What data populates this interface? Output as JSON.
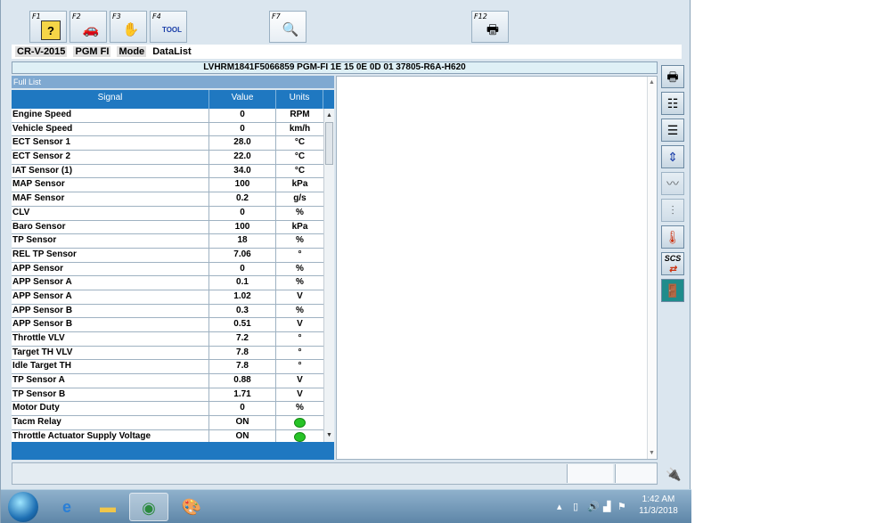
{
  "toolbar": {
    "keys": [
      {
        "label": "F1",
        "icon": "help-icon"
      },
      {
        "label": "F2",
        "icon": "car-icon"
      },
      {
        "label": "F3",
        "icon": "service-icon"
      },
      {
        "label": "F4",
        "icon": "tool-icon",
        "icon_text": "TOOL"
      },
      {
        "label": "F7",
        "icon": "datalist-icon"
      },
      {
        "label": "F12",
        "icon": "print-screen-icon"
      }
    ]
  },
  "breadcrumb": {
    "items": [
      "CR-V-2015",
      "PGM FI",
      "Mode",
      "DataList"
    ]
  },
  "vin_bar": "LVHRM1841F5066859  PGM-FI  1E 15 0E 0D 01  37805-R6A-H620",
  "list": {
    "title": "Full List",
    "columns": [
      "Signal",
      "Value",
      "Units"
    ],
    "rows": [
      {
        "signal": "Engine Speed",
        "value": "0",
        "unit": "RPM"
      },
      {
        "signal": "Vehicle Speed",
        "value": "0",
        "unit": "km/h"
      },
      {
        "signal": "ECT Sensor 1",
        "value": "28.0",
        "unit": "°C"
      },
      {
        "signal": "ECT Sensor 2",
        "value": "22.0",
        "unit": "°C"
      },
      {
        "signal": "IAT Sensor (1)",
        "value": "34.0",
        "unit": "°C"
      },
      {
        "signal": "MAP Sensor",
        "value": "100",
        "unit": "kPa"
      },
      {
        "signal": "MAF Sensor",
        "value": "0.2",
        "unit": "g/s"
      },
      {
        "signal": "CLV",
        "value": "0",
        "unit": "%"
      },
      {
        "signal": "Baro Sensor",
        "value": "100",
        "unit": "kPa"
      },
      {
        "signal": "TP Sensor",
        "value": "18",
        "unit": "%"
      },
      {
        "signal": "REL TP Sensor",
        "value": "7.06",
        "unit": "°"
      },
      {
        "signal": "APP Sensor",
        "value": "0",
        "unit": "%"
      },
      {
        "signal": "APP Sensor A",
        "value": "0.1",
        "unit": "%"
      },
      {
        "signal": "APP Sensor A",
        "value": "1.02",
        "unit": "V"
      },
      {
        "signal": "APP Sensor B",
        "value": "0.3",
        "unit": "%"
      },
      {
        "signal": "APP Sensor B",
        "value": "0.51",
        "unit": "V"
      },
      {
        "signal": "Throttle VLV",
        "value": "7.2",
        "unit": "°"
      },
      {
        "signal": "Target TH VLV",
        "value": "7.8",
        "unit": "°"
      },
      {
        "signal": "Idle Target TH",
        "value": "7.8",
        "unit": "°"
      },
      {
        "signal": "TP Sensor A",
        "value": "0.88",
        "unit": "V"
      },
      {
        "signal": "TP Sensor B",
        "value": "1.71",
        "unit": "V"
      },
      {
        "signal": "Motor Duty",
        "value": "0",
        "unit": "%"
      },
      {
        "signal": "Tacm Relay",
        "value": "ON",
        "unit": "",
        "indicator": true
      },
      {
        "signal": "Throttle Actuator Supply Voltage",
        "value": "ON",
        "unit": "",
        "indicator": true
      }
    ]
  },
  "side_buttons": [
    {
      "icon": "printer-icon"
    },
    {
      "icon": "select-signals-icon"
    },
    {
      "icon": "list-view-icon"
    },
    {
      "icon": "sort-icon"
    },
    {
      "icon": "graph-icon"
    },
    {
      "icon": "filter-icon"
    },
    {
      "icon": "temperature-icon"
    },
    {
      "icon": "scs-icon",
      "text": "SCS"
    },
    {
      "icon": "exit-icon"
    }
  ],
  "taskbar": {
    "apps": [
      "ie-icon",
      "folder-icon",
      "hds-icon",
      "paint-icon"
    ],
    "clock": {
      "time": "1:42 AM",
      "date": "11/3/2018"
    }
  },
  "colors": {
    "header_blue": "#1f78c1",
    "indicator_green": "#27c327"
  }
}
